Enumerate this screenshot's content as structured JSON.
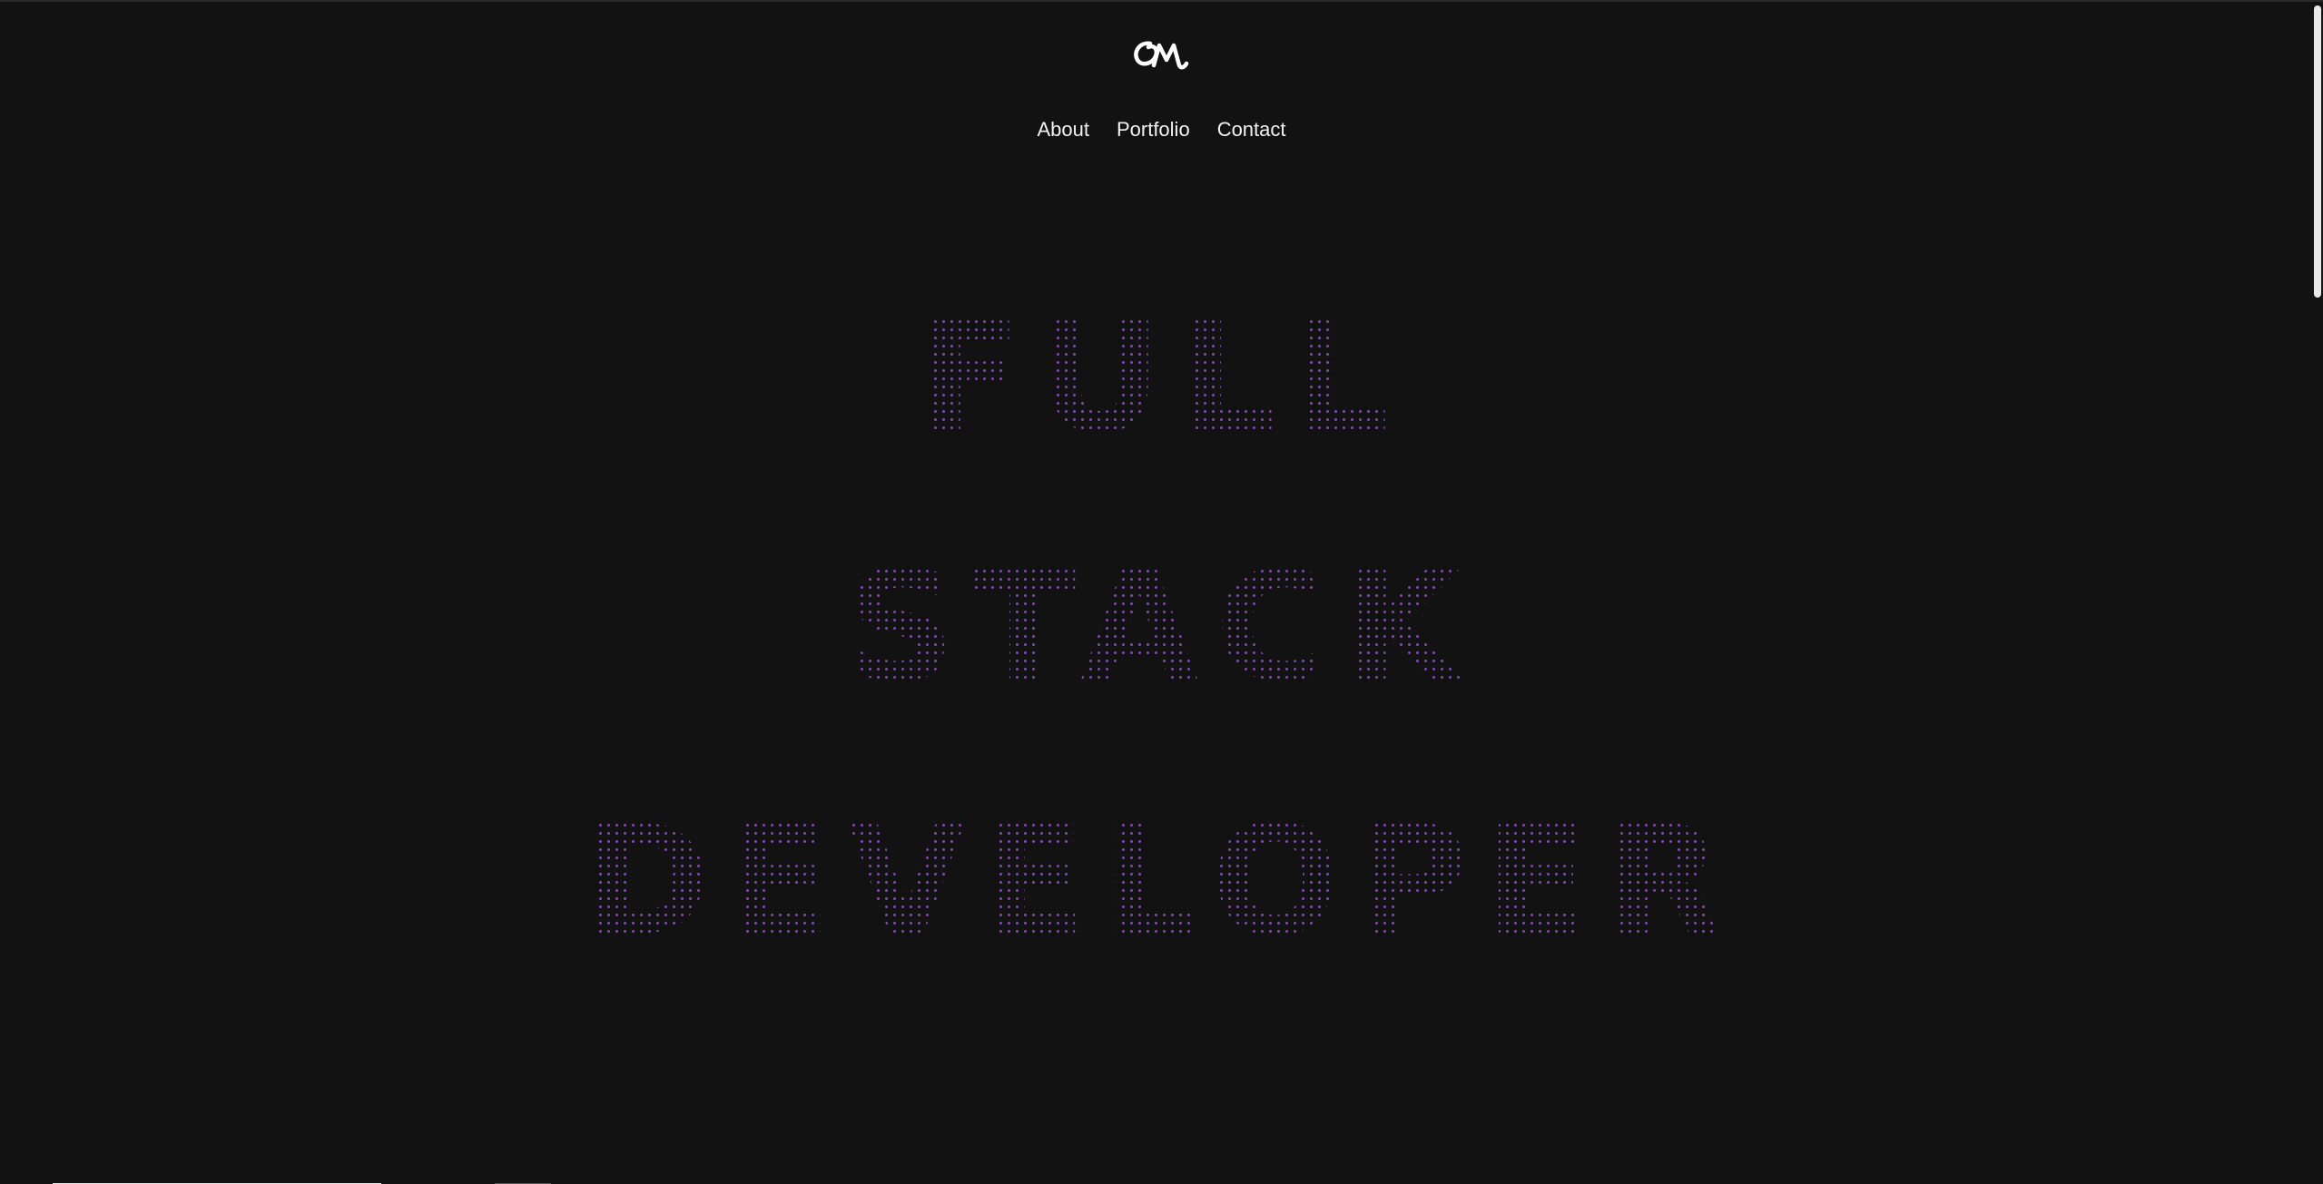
{
  "header": {
    "logo_text": "OM",
    "logo_icon": "om-monogram-logo"
  },
  "nav": {
    "items": [
      {
        "label": "About"
      },
      {
        "label": "Portfolio"
      },
      {
        "label": "Contact"
      }
    ]
  },
  "hero": {
    "lines": [
      "FULL",
      "STACK",
      "DEVELOPER"
    ]
  },
  "colors": {
    "background": "#121212",
    "dot_accent": "#9650c8",
    "nav_text": "#f2f2f2"
  }
}
